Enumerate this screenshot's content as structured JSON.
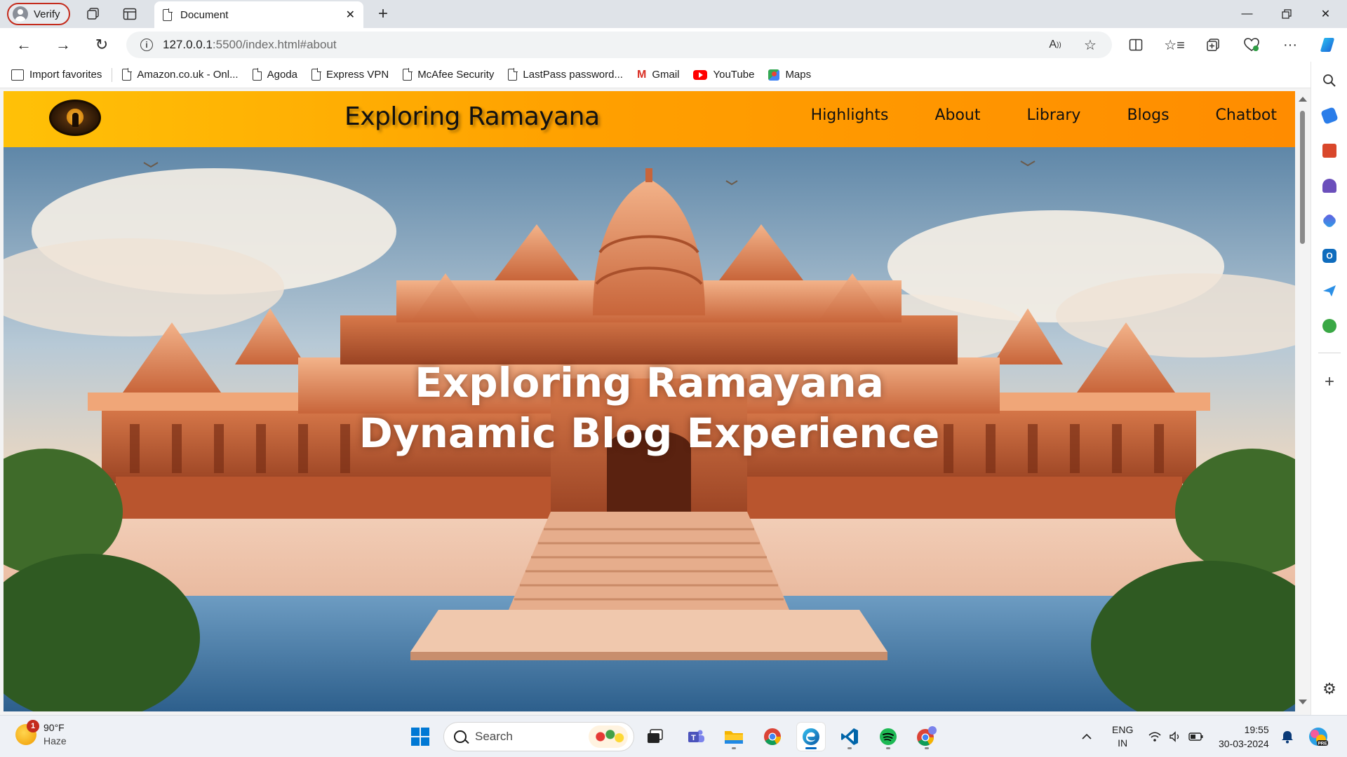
{
  "browser": {
    "profile_label": "Verify",
    "tab_title": "Document",
    "url_host": "127.0.0.1",
    "url_path": ":5500/index.html#about",
    "favorites": [
      {
        "label": "Import favorites",
        "icon": "import-icon"
      },
      {
        "label": "Amazon.co.uk - Onl...",
        "icon": "page-icon"
      },
      {
        "label": "Agoda",
        "icon": "page-icon"
      },
      {
        "label": "Express VPN",
        "icon": "page-icon"
      },
      {
        "label": "McAfee Security",
        "icon": "page-icon"
      },
      {
        "label": "LastPass password...",
        "icon": "page-icon"
      },
      {
        "label": "Gmail",
        "icon": "gmail-icon"
      },
      {
        "label": "YouTube",
        "icon": "youtube-icon"
      },
      {
        "label": "Maps",
        "icon": "maps-icon"
      }
    ]
  },
  "site": {
    "title": "Exploring Ramayana",
    "nav": [
      "Highlights",
      "About",
      "Library",
      "Blogs",
      "Chatbot"
    ],
    "hero_line1": "Exploring Ramayana",
    "hero_line2": "Dynamic Blog Experience"
  },
  "taskbar": {
    "temperature": "90°F",
    "condition": "Haze",
    "weather_badge": "1",
    "search_placeholder": "Search",
    "language": "ENG",
    "region": "IN",
    "time": "19:55",
    "date": "30-03-2024"
  },
  "colors": {
    "nav_gradient_start": "#ffc107",
    "nav_gradient_end": "#ff8c00",
    "edge_accent": "#0078d4",
    "profile_border": "#c42b1c"
  }
}
